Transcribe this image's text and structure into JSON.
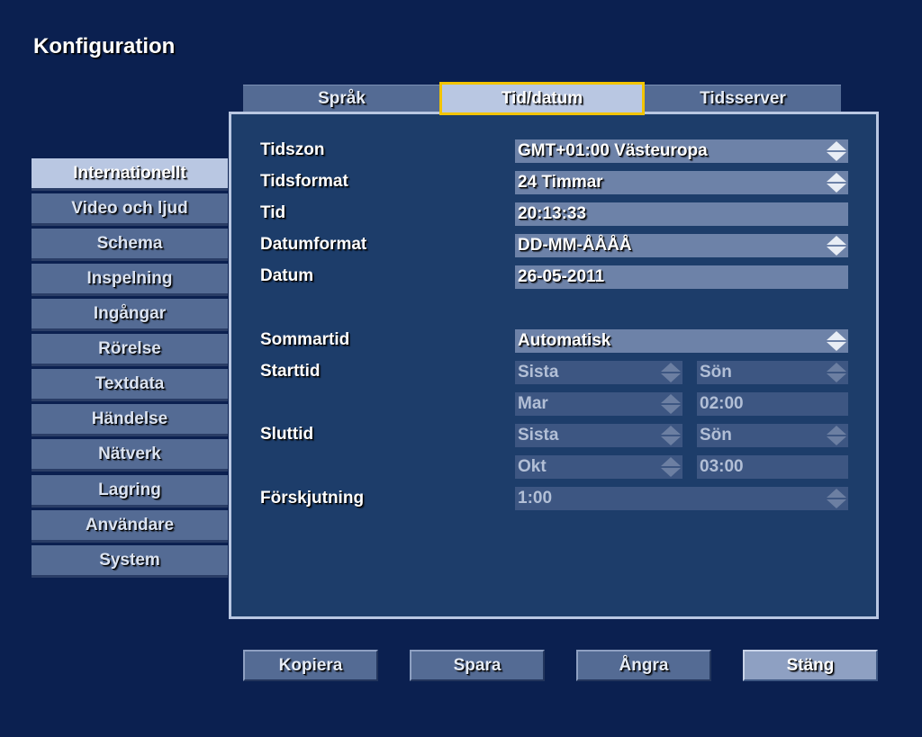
{
  "window": {
    "title": "Konfiguration"
  },
  "tabs": [
    {
      "label": "Språk"
    },
    {
      "label": "Tid/datum"
    },
    {
      "label": "Tidsserver"
    }
  ],
  "sidebar": {
    "items": [
      {
        "label": "Internationellt"
      },
      {
        "label": "Video och ljud"
      },
      {
        "label": "Schema"
      },
      {
        "label": "Inspelning"
      },
      {
        "label": "Ingångar"
      },
      {
        "label": "Rörelse"
      },
      {
        "label": "Textdata"
      },
      {
        "label": "Händelse"
      },
      {
        "label": "Nätverk"
      },
      {
        "label": "Lagring"
      },
      {
        "label": "Användare"
      },
      {
        "label": "System"
      }
    ]
  },
  "form": {
    "tidszon": {
      "label": "Tidszon",
      "value": "GMT+01:00 Västeuropa"
    },
    "tidsformat": {
      "label": "Tidsformat",
      "value": "24 Timmar"
    },
    "tid": {
      "label": "Tid",
      "value": "20:13:33"
    },
    "datumformat": {
      "label": "Datumformat",
      "value": "DD-MM-ÅÅÅÅ"
    },
    "datum": {
      "label": "Datum",
      "value": "26-05-2011"
    },
    "sommartid": {
      "label": "Sommartid",
      "value": "Automatisk"
    },
    "starttid": {
      "label": "Starttid",
      "week": "Sista",
      "day": "Sön",
      "month": "Mar",
      "time": "02:00"
    },
    "sluttid": {
      "label": "Sluttid",
      "week": "Sista",
      "day": "Sön",
      "month": "Okt",
      "time": "03:00"
    },
    "forskjutning": {
      "label": "Förskjutning",
      "value": "1:00"
    }
  },
  "buttons": {
    "kopiera": "Kopiera",
    "spara": "Spara",
    "angra": "Ångra",
    "stang": "Stäng"
  },
  "colors": {
    "background": "#0b2050",
    "panel": "#1d3d6a",
    "active_tab_border": "#f2c400"
  }
}
